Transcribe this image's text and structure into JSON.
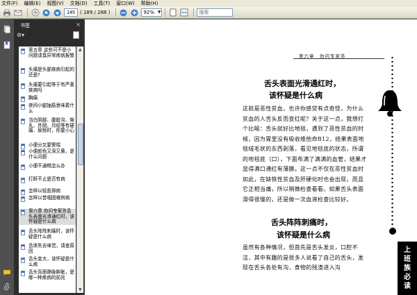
{
  "menu": [
    "文件(F)",
    "编辑(E)",
    "视图(V)",
    "文档(D)",
    "工具(T)",
    "窗口(W)",
    "帮助(H)"
  ],
  "toolbar": {
    "page_current": "145",
    "page_total": "( 189 / 288 )",
    "zoom": "92%",
    "search_placeholder": "搜索"
  },
  "panel": {
    "title": "书签",
    "close": "×",
    "options_icon": "options-icon",
    "bookmark_icon": "new-bookmark-icon"
  },
  "bookmarks": [
    {
      "text": "第五章 这些可不是小问题请臭异常疾病报警"
    },
    {
      "text": "头痛是头部疾病引起的还是?"
    },
    {
      "text": "头痛要引起等于有严重疾病吗"
    },
    {
      "text": "胸痛"
    },
    {
      "text": "夜间小腿抽筋意味着什么"
    },
    {
      "text": "当白阴部、腹股沟、臀丸、外阴、月经等有硬痛、尿频时，你要小心"
    },
    {
      "text": "小便分叉要警惕"
    },
    {
      "text": "小便颜色又深又黄，是什么问题"
    },
    {
      "text": "小便不通畅怎么办"
    },
    {
      "text": "打鼾不止是否有病"
    },
    {
      "text": "怎样以轻盈排病"
    },
    {
      "text": "怎样以苦咽困难辨病"
    },
    {
      "text": "第六章 你问专家答舌头表面光滑通红时，该怀疑是什么病"
    },
    {
      "text": "舌头阵阵刺痛时，该怀疑是什么病"
    },
    {
      "text": "舌体失去味觉，请查原因"
    },
    {
      "text": "舌头变大，该怀疑是什么病"
    },
    {
      "text": "舌头背面静脉肿胀，是哪一种疾病的前兆"
    }
  ],
  "document": {
    "running_head": "第六章　你问专家答",
    "section1": {
      "title_line1": "舌头表面光滑通红时，",
      "title_line2": "该怀疑是什么病",
      "paragraph": "这就是恶性贫血，也许你感觉有点奇怪，为什么贫血的人舌头反而变红呢？关于这一点，我想打个比喻：舌头就好比地毯，遇到了恶性贫血的时候，因为胃里没有吸收维他命B12，结果表面地毯绒毛状的东西剥落，看见地毯底的状态，所谓的地毯底（口），下面布满了满满的血管，结果才显得满口通红有薄膜。这一点不仅在恶性贫血时如此，在缺铁性贫血及肝硬化时也会出现，而且它正相当痛，所以稍微检查看看。如果舌头表面滑得很慢的，还是做一次血液检查比较好。"
    },
    "section2": {
      "title_line1": "舌头阵阵刺痛时，",
      "title_line2": "该怀疑是什么病",
      "paragraph": "虽然有各种情况，但首先是舌头发炎，口腔不洁，其中有趣的是很多人说看了自己的舌头，发现在舌头各处有沟，食物的残渣进入沟"
    },
    "side_tab": [
      "上",
      "班",
      "族",
      "必",
      "读"
    ]
  },
  "colors": {
    "chrome": "#ece9d8",
    "panel_bg": "#2c2c2c",
    "doc_bg": "#585858",
    "page_bg": "#ffffff"
  }
}
